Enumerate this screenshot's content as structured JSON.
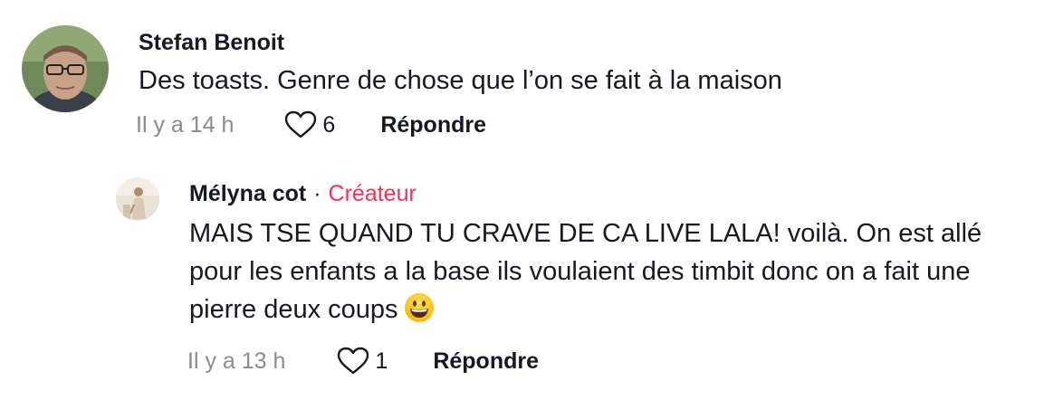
{
  "comments": [
    {
      "author": "Stefan Benoit",
      "text": "Des toasts. Genre de chose que l’on se fait à la maison",
      "time": "Il y a 14 h",
      "likes": "6",
      "reply_label": "Répondre"
    }
  ],
  "reply": {
    "author": "Mélyna cot",
    "separator": "·",
    "badge": "Créateur",
    "text": "MAIS TSE QUAND TU CRAVE DE CA LIVE LALA! voilà. On est allé pour les enfants a la base ils voulaient des timbit donc on a fait une pierre deux coups",
    "emoji": "grinning-face-emoji",
    "time": "Il y a 13 h",
    "likes": "1",
    "reply_label": "Répondre"
  },
  "colors": {
    "creator_badge": "#fe2c55",
    "muted_text": "#8a8b91",
    "primary_text": "#161823"
  }
}
